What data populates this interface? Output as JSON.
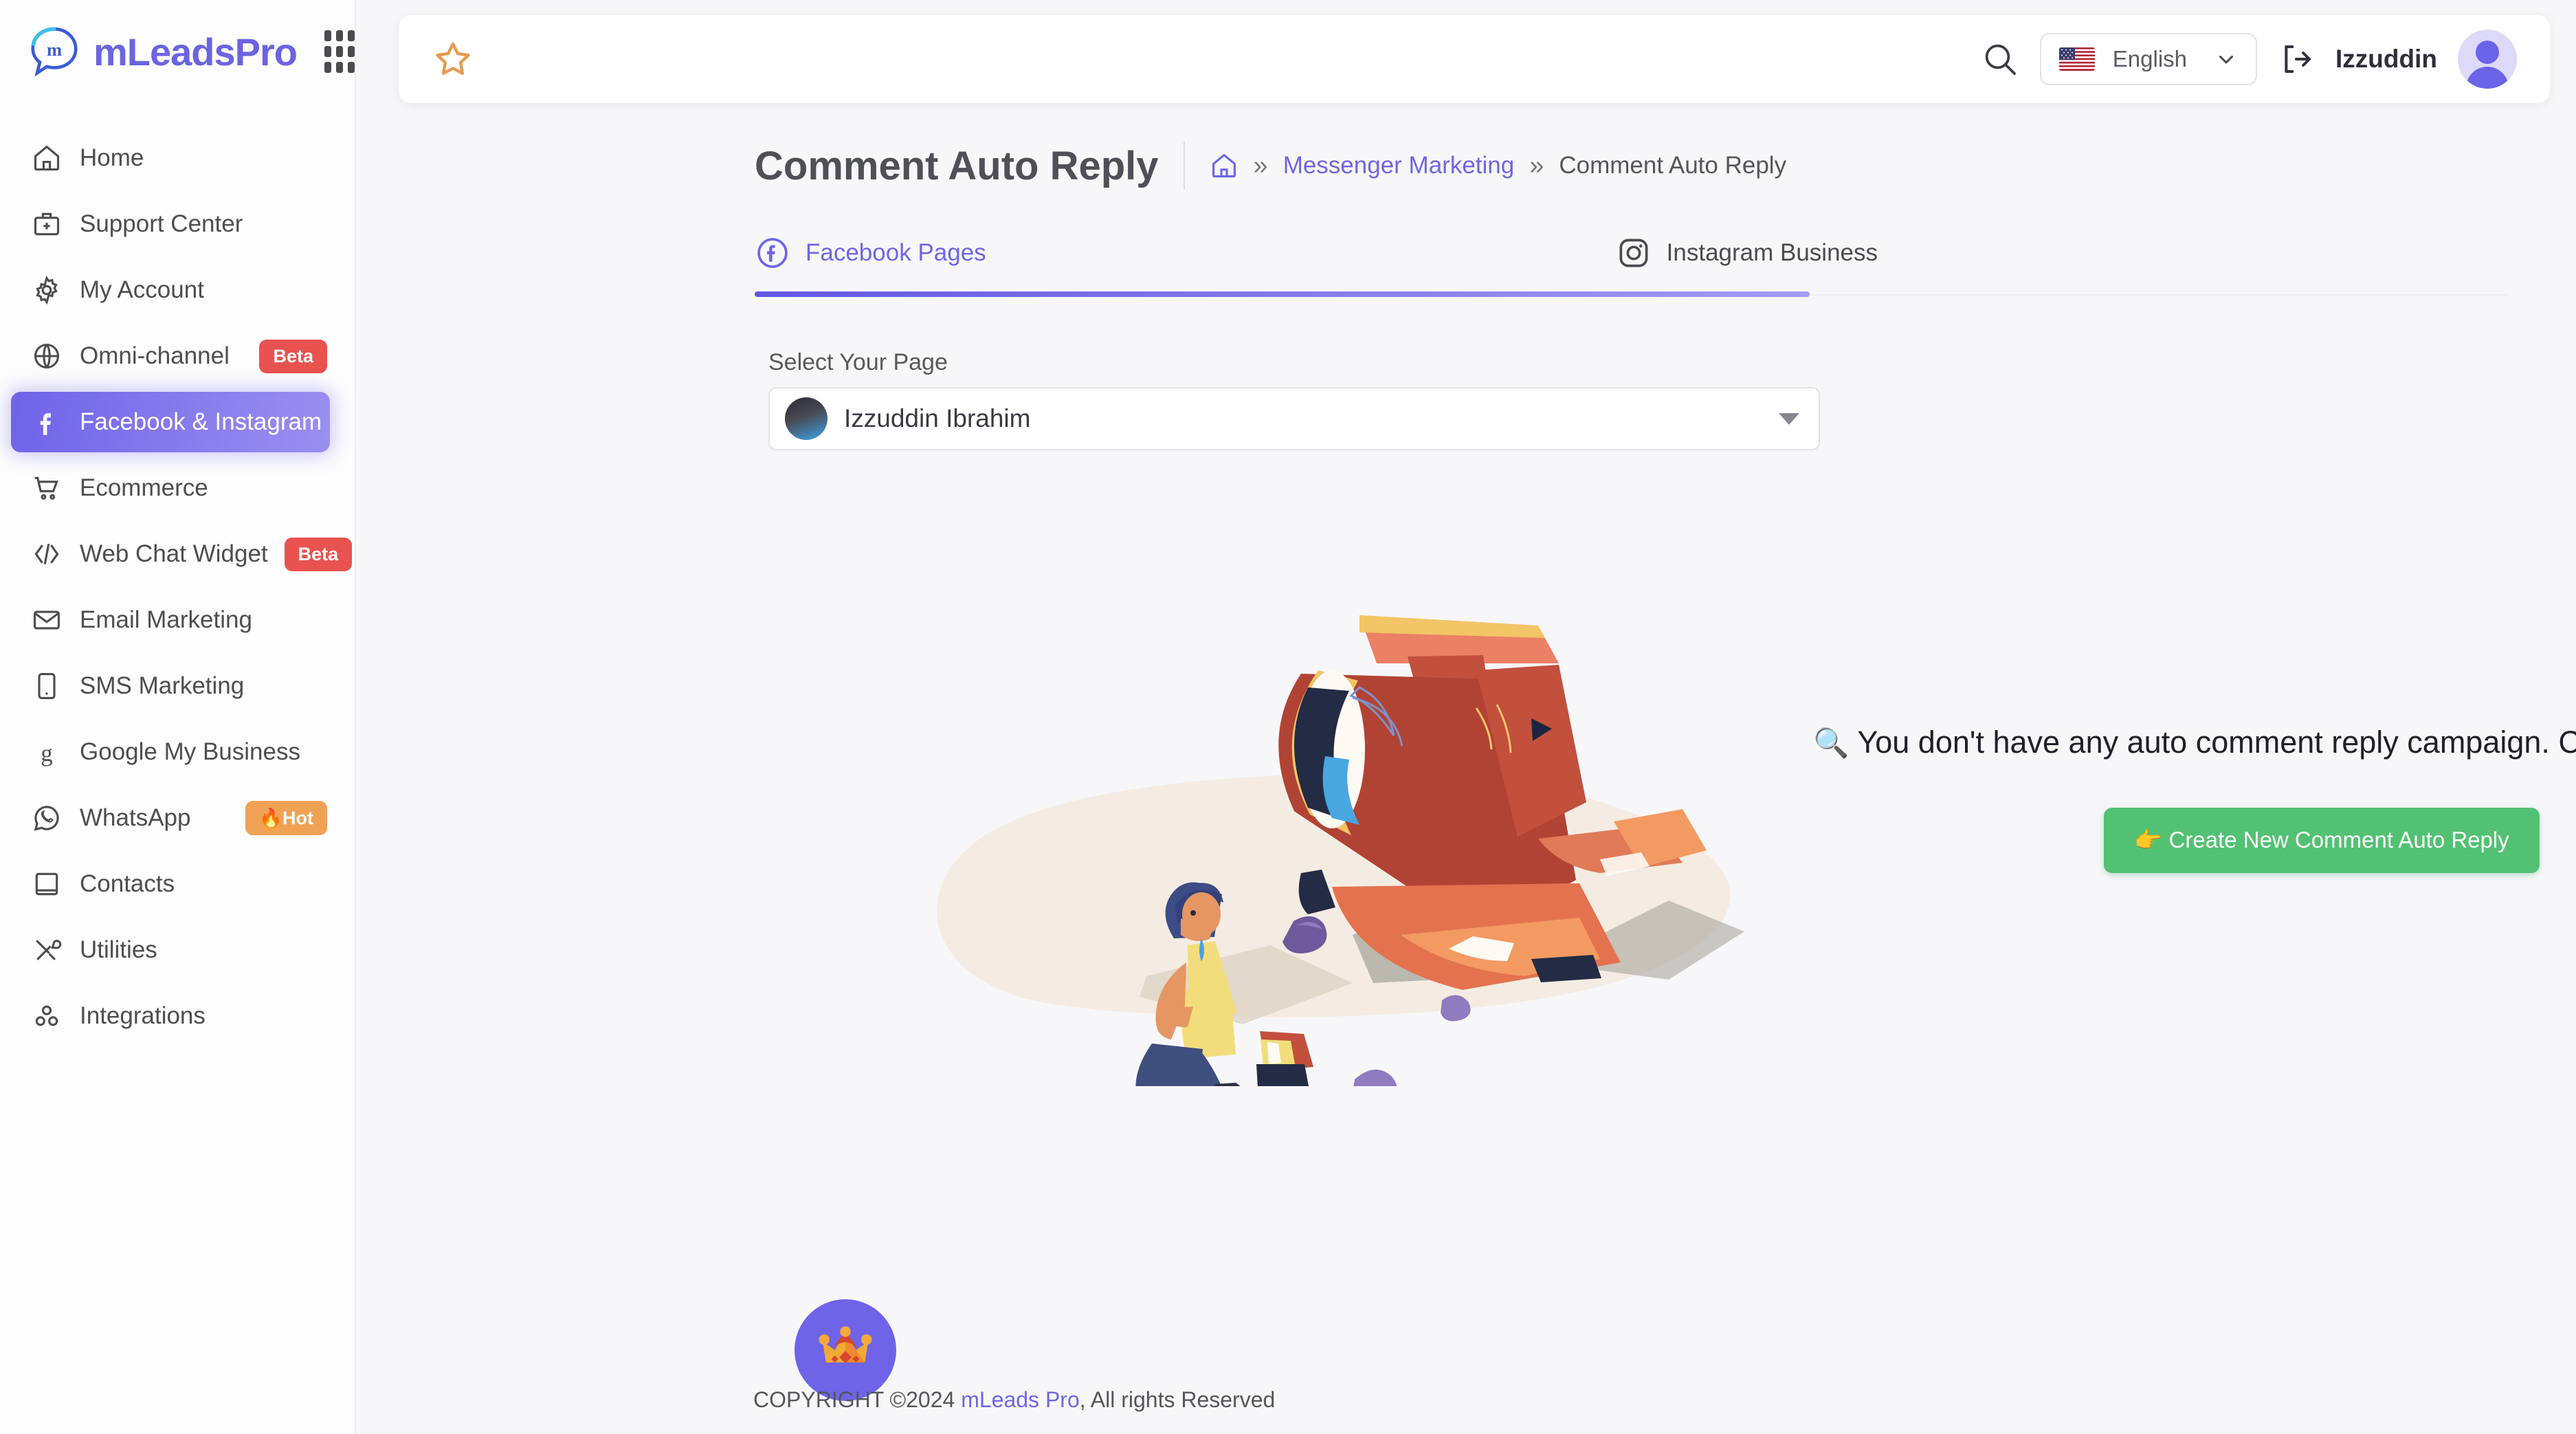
{
  "brand": {
    "name": "mLeadsPro",
    "apps_icon": "apps-grid-icon"
  },
  "sidebar": {
    "items": [
      {
        "label": "Home",
        "icon": "home-icon",
        "badge": null,
        "active": false
      },
      {
        "label": "Support Center",
        "icon": "briefcase-plus-icon",
        "badge": null,
        "active": false
      },
      {
        "label": "My Account",
        "icon": "gear-icon",
        "badge": null,
        "active": false
      },
      {
        "label": "Omni-channel",
        "icon": "globe-icon",
        "badge": "Beta",
        "badge_type": "beta",
        "active": false
      },
      {
        "label": "Facebook & Instagram",
        "icon": "facebook-icon",
        "badge": null,
        "active": true
      },
      {
        "label": "Ecommerce",
        "icon": "shopping-cart-icon",
        "badge": null,
        "active": false
      },
      {
        "label": "Web Chat Widget",
        "icon": "code-icon",
        "badge": "Beta",
        "badge_type": "beta",
        "active": false
      },
      {
        "label": "Email Marketing",
        "icon": "envelope-icon",
        "badge": null,
        "active": false
      },
      {
        "label": "SMS Marketing",
        "icon": "mobile-icon",
        "badge": null,
        "active": false
      },
      {
        "label": "Google My Business",
        "icon": "google-icon",
        "badge": null,
        "active": false
      },
      {
        "label": "WhatsApp",
        "icon": "whatsapp-icon",
        "badge": "🔥Hot",
        "badge_type": "hot",
        "active": false
      },
      {
        "label": "Contacts",
        "icon": "contacts-book-icon",
        "badge": null,
        "active": false
      },
      {
        "label": "Utilities",
        "icon": "tools-icon",
        "badge": null,
        "active": false
      },
      {
        "label": "Integrations",
        "icon": "integrations-gears-icon",
        "badge": null,
        "active": false
      }
    ]
  },
  "topbar": {
    "star_icon": "star-outline-icon",
    "search_icon": "search-icon",
    "language": "English",
    "language_flag": "us-flag-icon",
    "logout_icon": "logout-icon",
    "user_name": "Izzuddin",
    "avatar": "user-avatar"
  },
  "page": {
    "title": "Comment Auto Reply",
    "breadcrumb": {
      "home_icon": "home-icon",
      "separator": "»",
      "link": "Messenger Marketing",
      "current": "Comment Auto Reply"
    }
  },
  "tabs": [
    {
      "label": "Facebook Pages",
      "icon": "facebook-circle-icon",
      "active": true
    },
    {
      "label": "Instagram Business",
      "icon": "instagram-icon",
      "active": false
    }
  ],
  "select_page": {
    "label": "Select Your Page",
    "value": "Izzuddin Ibrahim",
    "caret_icon": "caret-down-icon"
  },
  "empty_state": {
    "illustration": "crashed-airplane-illustration",
    "magnifier": "🔍",
    "message": "You don't have any auto comment reply campaign. Create the first one.",
    "button_label": "👉 Create New Comment Auto Reply",
    "button_color": "#53c173"
  },
  "fabs": {
    "crown": "crown-icon",
    "support": "lifebuoy-support-icon"
  },
  "footer": {
    "prefix": "COPYRIGHT ©2024 ",
    "link": "mLeads Pro",
    "suffix": ", All rights Reserved"
  },
  "colors": {
    "accent": "#6f66e4",
    "beta_badge": "#e8524f",
    "hot_badge": "#f0a254",
    "success": "#53c173",
    "star": "#e89a4e"
  }
}
